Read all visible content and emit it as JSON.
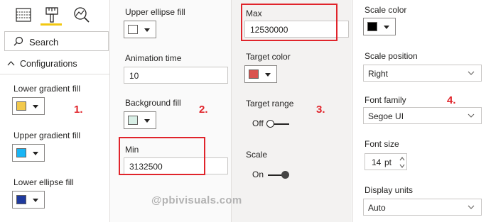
{
  "toolbar": {
    "icons": [
      "fields-icon",
      "format-paint-icon",
      "analytics-icon"
    ],
    "active": "format-paint-icon",
    "accent_color": "#f2c811"
  },
  "search": {
    "placeholder": "Search"
  },
  "section": {
    "label": "Configurations",
    "expanded": true
  },
  "panel1": {
    "lower_gradient": {
      "label": "Lower gradient fill",
      "color": "#f2c94c"
    },
    "upper_gradient": {
      "label": "Upper gradient fill",
      "color": "#19b5f5"
    },
    "lower_ellipse": {
      "label": "Lower ellipse fill",
      "color": "#1f3a9e"
    },
    "marker": "1."
  },
  "panel2": {
    "upper_ellipse": {
      "label": "Upper ellipse fill",
      "color": "#ffffff"
    },
    "animation_time": {
      "label": "Animation time",
      "value": "10"
    },
    "background_fill": {
      "label": "Background fill",
      "color": "#d8efe6"
    },
    "min": {
      "label": "Min",
      "value": "3132500"
    },
    "marker": "2."
  },
  "panel3": {
    "max": {
      "label": "Max",
      "value": "12530000"
    },
    "target_color": {
      "label": "Target color",
      "color": "#d9534f"
    },
    "target_range": {
      "label": "Target range",
      "state": "Off"
    },
    "scale": {
      "label": "Scale",
      "state": "On"
    },
    "marker": "3."
  },
  "panel4": {
    "scale_color": {
      "label": "Scale color",
      "color": "#000000"
    },
    "scale_position": {
      "label": "Scale position",
      "value": "Right"
    },
    "font_family": {
      "label": "Font family",
      "value": "Segoe UI"
    },
    "font_size": {
      "label": "Font size",
      "value": "14",
      "unit": "pt"
    },
    "display_units": {
      "label": "Display units",
      "value": "Auto"
    },
    "marker": "4."
  },
  "watermark": "@pbivisuals.com",
  "highlight_color": "#e0242b"
}
